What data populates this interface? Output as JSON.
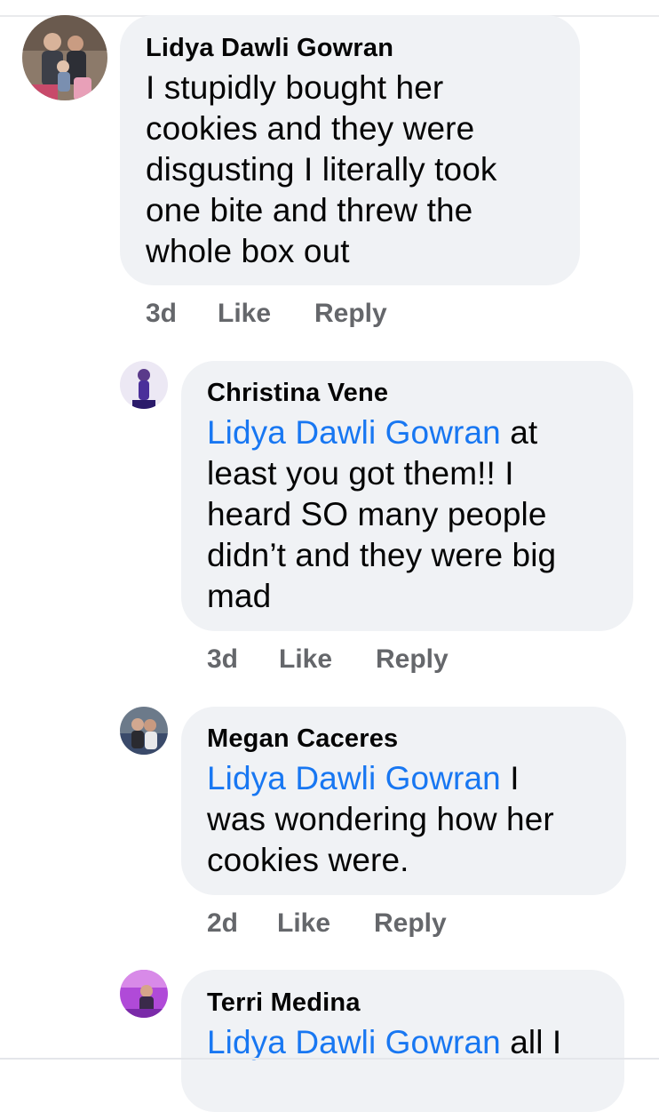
{
  "comments": [
    {
      "author": "Lidya Dawli Gowran",
      "lines": [
        "I stupidly bought her",
        "cookies and they were",
        "disgusting I literally took",
        "one bite and threw the",
        "whole box out"
      ],
      "time": "3d",
      "like": "Like",
      "reply": "Reply"
    },
    {
      "author": "Christina Vene",
      "mention": "Lidya Dawli Gowran",
      "first_line_rest": " at",
      "lines": [
        "least you got them!! I",
        "heard SO many people",
        "didn’t and they were big",
        "mad"
      ],
      "time": "3d",
      "like": "Like",
      "reply": "Reply"
    },
    {
      "author": "Megan Caceres",
      "mention": "Lidya Dawli Gowran",
      "first_line_rest": " I",
      "lines": [
        "was wondering how her",
        "cookies were."
      ],
      "time": "2d",
      "like": "Like",
      "reply": "Reply"
    },
    {
      "author": "Terri Medina",
      "mention": "Lidya Dawli Gowran",
      "first_line_rest": " all I",
      "lines": []
    }
  ],
  "colors": {
    "bubble": "#f0f2f5",
    "mention": "#1877f2",
    "meta": "#65676b"
  }
}
